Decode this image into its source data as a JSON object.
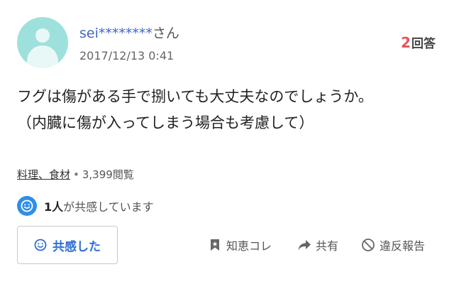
{
  "user": {
    "name": "sei********",
    "suffix": "さん",
    "date": "2017/12/13 0:41"
  },
  "answers": {
    "count": "2",
    "label": "回答"
  },
  "question": {
    "lines": [
      "フグは傷がある手で捌いても大丈夫なのでしょうか。",
      "（内臓に傷が入ってしまう場合も考慮して）"
    ]
  },
  "meta": {
    "category": "料理、食材",
    "separator": "•",
    "views": "3,399閲覧"
  },
  "empathy": {
    "count": "1人",
    "text": "が共感しています",
    "button_label": "共感した"
  },
  "actions": {
    "bookmark": "知恵コレ",
    "share": "共有",
    "report": "違反報告"
  },
  "colors": {
    "accent_blue": "#2f6ed4",
    "badge_blue": "#2f8ee8",
    "answer_red": "#e0565a",
    "avatar_bg": "#9ee0dc"
  },
  "icons": {
    "avatar": "user-avatar-icon",
    "empathy": "smiley-icon",
    "bookmark": "bookmark-icon",
    "share": "share-arrow-icon",
    "report": "prohibited-icon"
  }
}
